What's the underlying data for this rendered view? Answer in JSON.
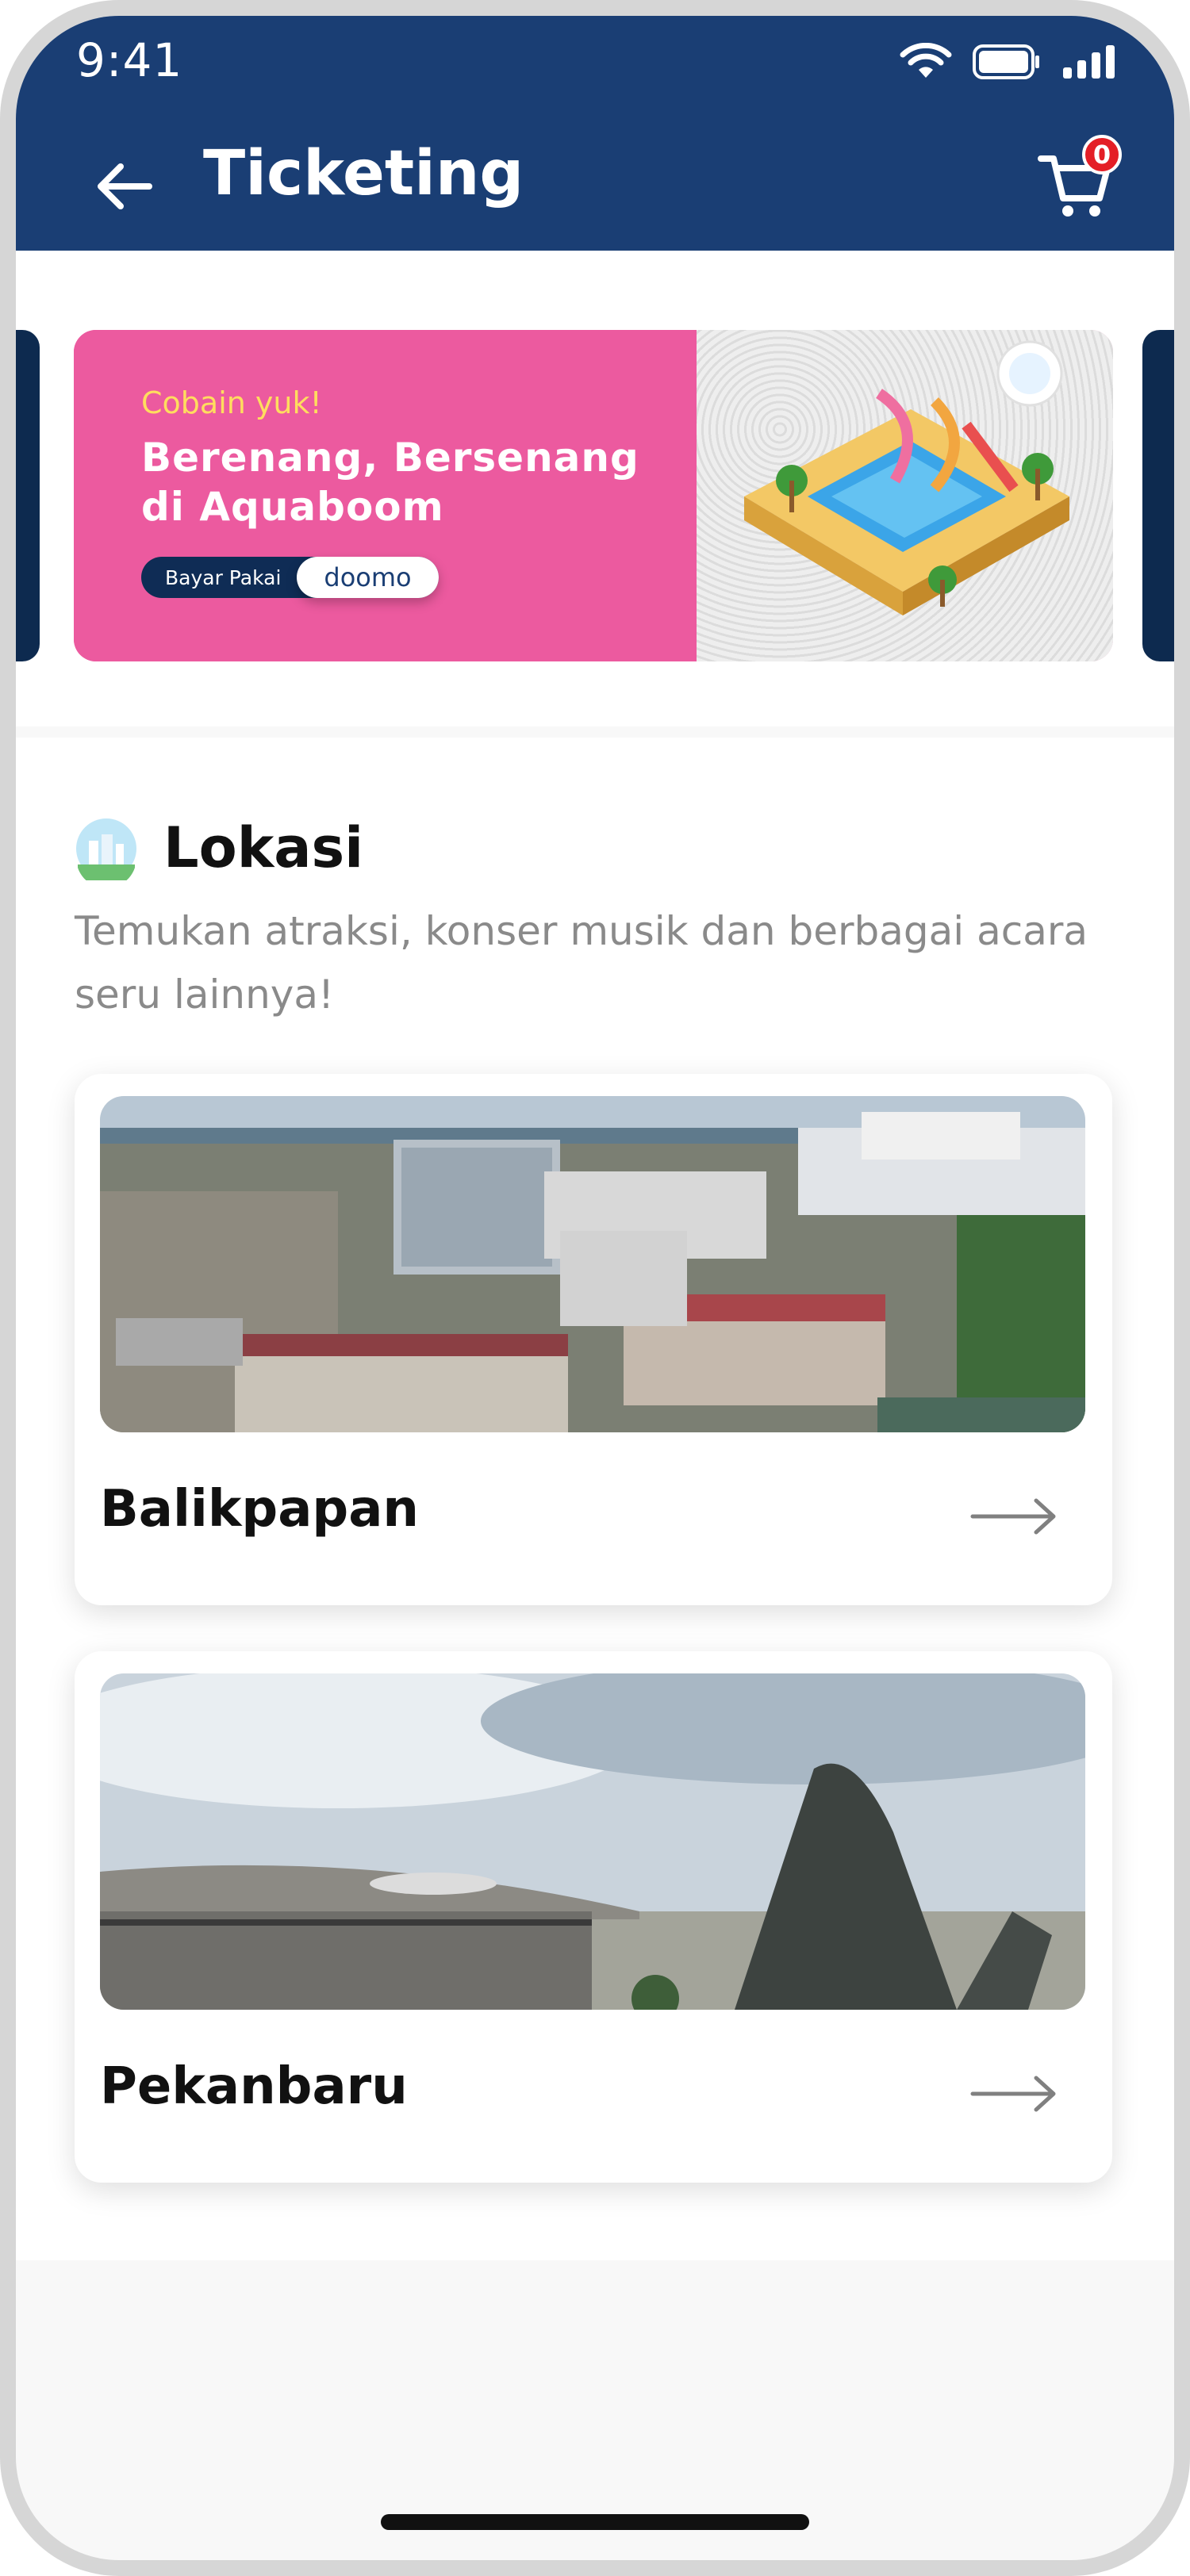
{
  "status_bar": {
    "time": "9:41",
    "icons": [
      "wifi-icon",
      "battery-icon",
      "signal-icon"
    ]
  },
  "header": {
    "title": "Ticketing",
    "back_icon": "arrow-left-icon",
    "cart_icon": "cart-icon",
    "cart_count": "0",
    "background": "#1a3e74"
  },
  "banner": {
    "tagline": "Cobain yuk!",
    "headline": "Berenang, Bersenang di Aquaboom",
    "pay_label": "Bayar Pakai",
    "pay_brand": "doomo",
    "background": "#ec5a9f",
    "tagline_color": "#ffdd5e"
  },
  "lokasi": {
    "title": "Lokasi",
    "subtitle": "Temukan atraksi, konser musik dan berbagai acara seru lainnya!",
    "cards": [
      {
        "name": "Balikpapan",
        "arrow_icon": "arrow-right-icon"
      },
      {
        "name": "Pekanbaru",
        "arrow_icon": "arrow-right-icon"
      }
    ]
  }
}
